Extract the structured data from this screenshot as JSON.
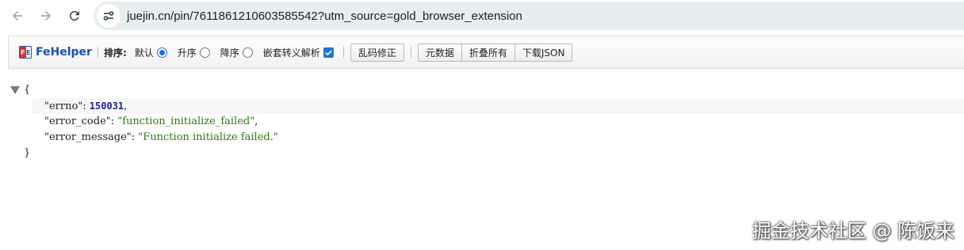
{
  "browser": {
    "url": "juejin.cn/pin/7611861210603585542?utm_source=gold_browser_extension",
    "icons": [
      "back-arrow-icon",
      "forward-arrow-icon",
      "reload-icon",
      "site-info-icon"
    ]
  },
  "fehelper": {
    "logo_text": "FeHelper",
    "sort_label": "排序:",
    "options": {
      "default": "默认",
      "ascending": "升序",
      "descending": "降序",
      "nested_escape": "嵌套转义解析"
    },
    "selected_sort": "默认",
    "nested_escape_checked": true,
    "buttons": {
      "fix_encoding": "乱码修正",
      "metadata": "元数据",
      "collapse_all": "折叠所有",
      "download_json": "下载JSON"
    },
    "colors": {
      "logo_blue": "#1d4fb8",
      "logo_red": "#e5312b",
      "accent": "#1a73e8"
    }
  },
  "json": {
    "open_brace": "{",
    "close_brace": "}",
    "entries": [
      {
        "key": "\"errno\"",
        "sep": ": ",
        "value": "150031",
        "type": "number",
        "tail": ","
      },
      {
        "key": "\"error_code\"",
        "sep": ": ",
        "value": "\"function_initialize_failed\"",
        "type": "string",
        "tail": ","
      },
      {
        "key": "\"error_message\"",
        "sep": ": ",
        "value": "\"Function initialize failed.\"",
        "type": "string",
        "tail": ""
      }
    ],
    "colors": {
      "number": "#1f1fa5",
      "string": "#2b7a0b"
    }
  },
  "watermark": "掘金技术社区 @ 陈饭来"
}
